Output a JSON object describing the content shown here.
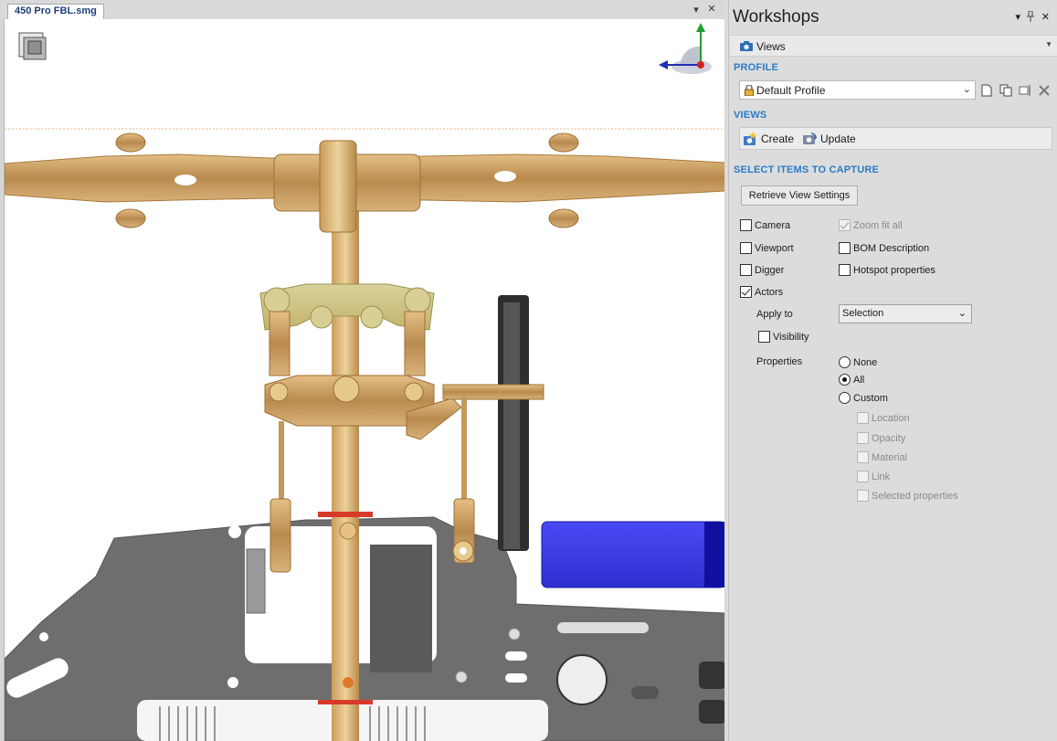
{
  "document": {
    "tab_title": "450 Pro FBL.smg",
    "pane_buttons": {
      "menu": "▾",
      "close": "✕"
    }
  },
  "workshops": {
    "title": "Workshops",
    "header_buttons": {
      "menu": "▾",
      "pin": "📌",
      "close": "✕"
    },
    "views_dropdown": {
      "label": "Views",
      "icon": "camera-icon"
    },
    "profile_section": "PROFILE",
    "profile_select": {
      "value": "Default Profile",
      "icon": "lock-icon"
    },
    "profile_tools": [
      "new-profile-icon",
      "copy-profile-icon",
      "rename-profile-icon",
      "delete-profile-icon"
    ],
    "views_section": "VIEWS",
    "views_toolbar": {
      "create_label": "Create",
      "update_label": "Update"
    },
    "capture_section": "SELECT ITEMS TO CAPTURE",
    "retrieve_button": "Retrieve View Settings",
    "options": {
      "camera": {
        "label": "Camera",
        "checked": false
      },
      "zoom_fit_all": {
        "label": "Zoom fit all",
        "checked": true,
        "disabled": true
      },
      "viewport": {
        "label": "Viewport",
        "checked": false
      },
      "bom_description": {
        "label": "BOM Description",
        "checked": false
      },
      "digger": {
        "label": "Digger",
        "checked": false
      },
      "hotspot_properties": {
        "label": "Hotspot properties",
        "checked": false
      },
      "actors": {
        "label": "Actors",
        "checked": true
      }
    },
    "apply_to": {
      "label": "Apply to",
      "value": "Selection"
    },
    "visibility": {
      "label": "Visibility",
      "checked": false
    },
    "properties": {
      "label": "Properties",
      "radios": [
        {
          "label": "None",
          "selected": false
        },
        {
          "label": "All",
          "selected": true
        },
        {
          "label": "Custom",
          "selected": false
        }
      ],
      "custom_items": [
        "Location",
        "Opacity",
        "Material",
        "Link",
        "Selected properties"
      ]
    }
  },
  "colors": {
    "accent": "#2a7bc8",
    "gold": "#c9a062",
    "blue_part": "#3a3ae8",
    "chassis": "#6b6b6b"
  }
}
